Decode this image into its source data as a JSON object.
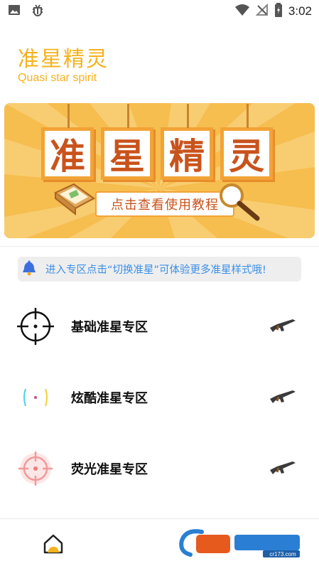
{
  "status_bar": {
    "time": "3:02",
    "left_icons": [
      "image-icon",
      "bug-icon"
    ],
    "right_icons": [
      "wifi-icon",
      "signal-off-icon",
      "battery-icon"
    ]
  },
  "header": {
    "title": "准星精灵",
    "subtitle": "Quasi star spirit"
  },
  "banner": {
    "tiles": [
      "准",
      "星",
      "精",
      "灵"
    ],
    "ribbon_text": "点击查看使用教程"
  },
  "notice": {
    "icon": "bell-icon",
    "text": "进入专区点击“切换准星”可体验更多准星样式哦!"
  },
  "zones": [
    {
      "label": "基础准星专区",
      "icon": "crosshair-basic-icon",
      "action_icon": "rifle-icon"
    },
    {
      "label": "炫酷准星专区",
      "icon": "crosshair-cool-icon",
      "action_icon": "rifle-icon"
    },
    {
      "label": "荧光准星专区",
      "icon": "crosshair-glow-icon",
      "action_icon": "rifle-icon"
    }
  ],
  "bottom_nav": {
    "home_icon": "home-icon",
    "watermark": "cr173.com"
  },
  "colors": {
    "accent": "#f6b21c",
    "notice_text": "#3a8fe8",
    "banner_bg": "#f5b94a"
  }
}
